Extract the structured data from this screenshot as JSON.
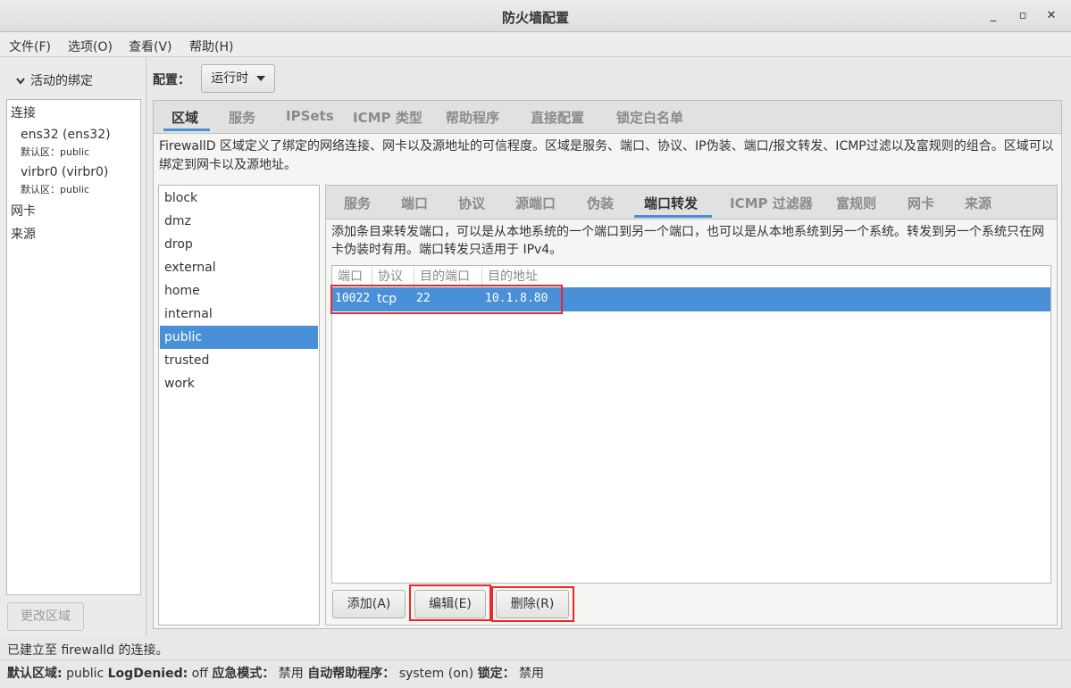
{
  "window": {
    "title": "防火墙配置",
    "minimize": "_",
    "maximize": "▫",
    "close": "✕"
  },
  "menu": [
    "文件(F)",
    "选项(O)",
    "查看(V)",
    "帮助(H)"
  ],
  "left": {
    "expander_label": "活动的绑定",
    "tree": {
      "connections_header": "连接",
      "connections": [
        {
          "name": "ens32 (ens32)",
          "zone_label": "默认区：",
          "zone": "public"
        },
        {
          "name": "virbr0 (virbr0)",
          "zone_label": "默认区：",
          "zone": "public"
        }
      ],
      "interfaces_header": "网卡",
      "sources_header": "来源"
    },
    "change_zone_button": "更改区域"
  },
  "config": {
    "label": "配置：",
    "value": "运行时"
  },
  "outer_tabs": [
    "区域",
    "服务",
    "IPSets",
    "ICMP 类型",
    "帮助程序",
    "直接配置",
    "锁定白名单"
  ],
  "outer_active": 0,
  "zone_description": "FirewallD 区域定义了绑定的网络连接、网卡以及源地址的可信程度。区域是服务、端口、协议、IP伪装、端口/报文转发、ICMP过滤以及富规则的组合。区域可以绑定到网卡以及源地址。",
  "zones": [
    "block",
    "dmz",
    "drop",
    "external",
    "home",
    "internal",
    "public",
    "trusted",
    "work"
  ],
  "selected_zone": "public",
  "inner_tabs": [
    "服务",
    "端口",
    "协议",
    "源端口",
    "伪装",
    "端口转发",
    "ICMP 过滤器",
    "富规则",
    "网卡",
    "来源"
  ],
  "inner_active": 5,
  "forward_description": "添加条目来转发端口，可以是从本地系统的一个端口到另一个端口，也可以是从本地系统到另一个系统。转发到另一个系统只在网卡伪装时有用。端口转发只适用于 IPv4。",
  "table": {
    "columns": [
      "端口",
      "协议",
      "目的端口",
      "目的地址"
    ],
    "rows": [
      {
        "port": "10022",
        "protocol": "tcp",
        "to_port": "22",
        "to_addr": "10.1.8.80"
      }
    ]
  },
  "buttons": {
    "add": "添加(A)",
    "edit": "编辑(E)",
    "remove": "删除(R)"
  },
  "status": {
    "connection": "已建立至  firewalld 的连接。",
    "default_zone_label": "默认区域:",
    "default_zone": "public",
    "logdenied_label": "LogDenied:",
    "logdenied": "off",
    "panic_label": "应急模式：",
    "panic": "禁用",
    "helpers_label": "自动帮助程序：",
    "helpers": "system (on)",
    "lockdown_label": "锁定：",
    "lockdown": "禁用"
  },
  "colors": {
    "accent": "#4a90d9",
    "highlight_box": "#e8282b"
  }
}
